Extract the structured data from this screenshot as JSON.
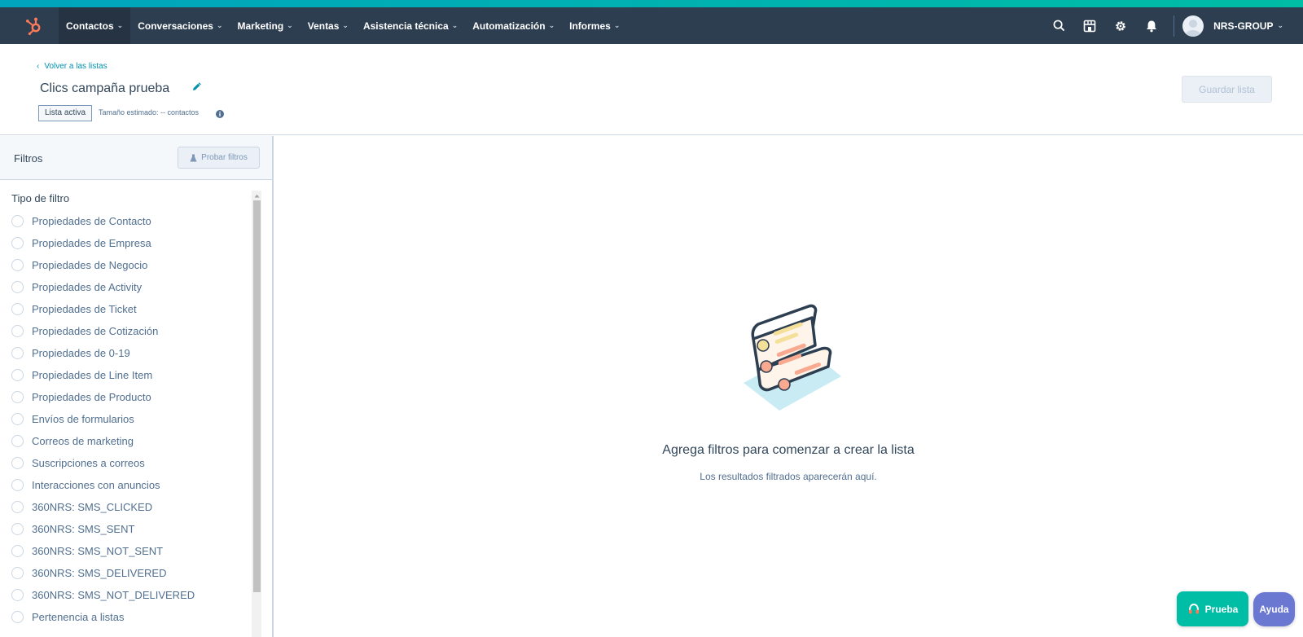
{
  "colors": {
    "nav_bg": "#2d3e50",
    "accent_strip": "#00bda5",
    "logo": "#ff7a59",
    "link": "#0091ae",
    "trial_btn": "#00bda5",
    "help_btn": "#6a78d1"
  },
  "nav": {
    "logo_icon": "hubspot-sprocket-icon",
    "items": [
      {
        "label": "Contactos"
      },
      {
        "label": "Conversaciones"
      },
      {
        "label": "Marketing"
      },
      {
        "label": "Ventas"
      },
      {
        "label": "Asistencia técnica"
      },
      {
        "label": "Automatización"
      },
      {
        "label": "Informes"
      }
    ],
    "right_icons": [
      "search-icon",
      "marketplace-icon",
      "settings-gear-icon",
      "notifications-bell-icon"
    ],
    "account_name": "NRS-GROUP"
  },
  "header": {
    "back_link": "Volver a las listas",
    "title": "Clics campaña prueba",
    "badge": "Lista activa",
    "size_text": "Tamaño estimado: -- contactos",
    "save_button": "Guardar lista"
  },
  "sidebar": {
    "title": "Filtros",
    "test_button": "Probar filtros",
    "filter_type_title": "Tipo de filtro",
    "filters": [
      "Propiedades de Contacto",
      "Propiedades de Empresa",
      "Propiedades de Negocio",
      "Propiedades de Activity",
      "Propiedades de Ticket",
      "Propiedades de Cotización",
      "Propiedades de 0-19",
      "Propiedades de Line Item",
      "Propiedades de Producto",
      "Envíos de formularios",
      "Correos de marketing",
      "Suscripciones a correos",
      "Interacciones con anuncios",
      "360NRS: SMS_CLICKED",
      "360NRS: SMS_SENT",
      "360NRS: SMS_NOT_SENT",
      "360NRS: SMS_DELIVERED",
      "360NRS: SMS_NOT_DELIVERED",
      "Pertenencia a listas"
    ]
  },
  "main": {
    "empty_title": "Agrega filtros para comenzar a crear la lista",
    "empty_subtitle": "Los resultados filtrados aparecerán aquí."
  },
  "floating": {
    "trial_button": "Prueba",
    "help_button": "Ayuda"
  }
}
